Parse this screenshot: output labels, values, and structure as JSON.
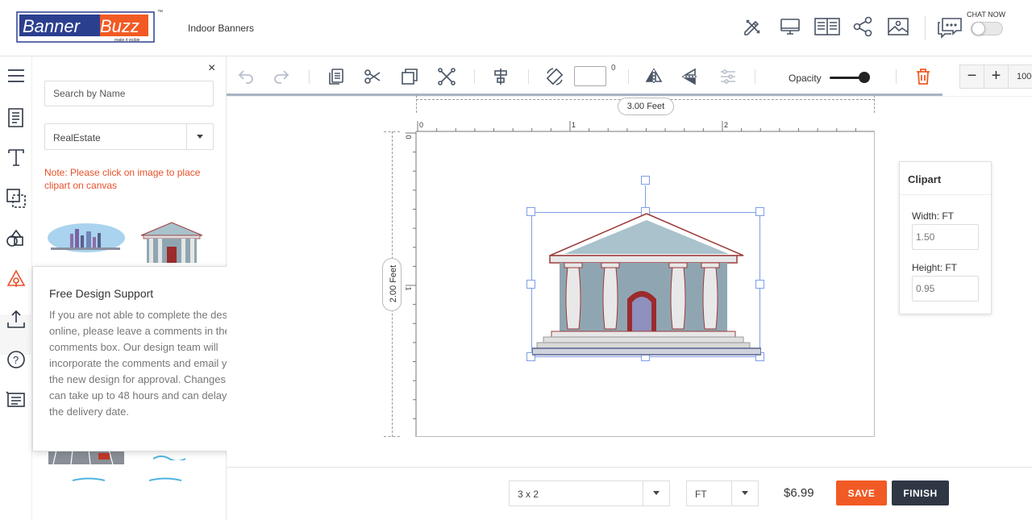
{
  "header": {
    "logo_text_1": "Banner",
    "logo_text_2": "Buzz",
    "logo_tagline": "make it visible",
    "logo_tm": "™",
    "product_title": "Indoor Banners",
    "icons": [
      "pencil-ruler-icon",
      "desktop-icon",
      "book-icon",
      "share-icon",
      "image-icon",
      "chat-icon"
    ],
    "chat_label": "CHAT NOW"
  },
  "rail": {
    "icons": [
      "menu-icon",
      "templates-icon",
      "text-icon",
      "layers-icon",
      "shapes-icon",
      "clipart-icon",
      "upload-icon",
      "help-icon",
      "comments-icon"
    ]
  },
  "panel": {
    "close": "×",
    "search_placeholder": "Search by Name",
    "category": "RealEstate",
    "note": "Note: Please click on image to place clipart on canvas"
  },
  "support": {
    "title": "Free Design Support",
    "close": "×",
    "body": "If you are not able to complete the design online, please leave a comments in the comments box. Our design team will incorporate the comments and email you the new design for approval. Changes can take up to 48 hours and can delay the delivery date."
  },
  "toolbar": {
    "icons": [
      "undo-icon",
      "redo-icon",
      "copy-icon",
      "cut-icon",
      "duplicate-icon",
      "delete-crop-icon",
      "align-center-icon",
      "rotate-icon",
      "flip-horizontal-icon",
      "flip-vertical-icon",
      "adjust-icon",
      "trash-icon"
    ],
    "rotation_value": "",
    "degree": "0",
    "opacity_label": "Opacity",
    "opacity_value": 1.0,
    "zoom_minus": "−",
    "zoom_plus": "+",
    "zoom_value": "100"
  },
  "canvas": {
    "width_label": "3.00 Feet",
    "height_label": "2.00 Feet",
    "ruler_top": [
      "0",
      "1",
      "2"
    ],
    "ruler_left": [
      "0",
      "1"
    ]
  },
  "clipart": {
    "title": "Clipart",
    "width_label": "Width: FT",
    "width_value": "1.50",
    "height_label": "Height: FT",
    "height_value": "0.95"
  },
  "footer": {
    "size": "3 x 2",
    "unit": "FT",
    "price": "$6.99",
    "save": "SAVE",
    "finish": "FINISH"
  },
  "colors": {
    "brand_blue": "#2b3f8f",
    "brand_orange": "#f15a24",
    "note_red": "#e8502a",
    "finish_dark": "#2f3745"
  }
}
